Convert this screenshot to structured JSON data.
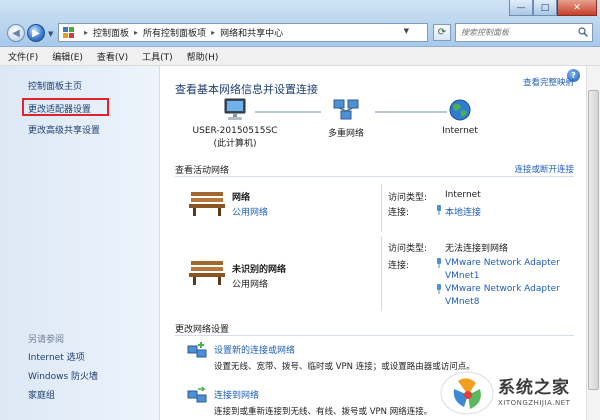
{
  "window": {
    "min_glyph": "—",
    "max_glyph": "□",
    "close_glyph": "✕"
  },
  "address": {
    "crumbs": [
      "控制面板",
      "所有控制面板项",
      "网络和共享中心"
    ],
    "search_placeholder": "搜索控制面板"
  },
  "menu": [
    "文件(F)",
    "编辑(E)",
    "查看(V)",
    "工具(T)",
    "帮助(H)"
  ],
  "left_pane": {
    "home": "控制面板主页",
    "adapter_settings": "更改适配器设置",
    "advanced_sharing": "更改高级共享设置",
    "see_also": "另请参阅",
    "internet_options": "Internet 选项",
    "firewall": "Windows 防火墙",
    "homegroup": "家庭组"
  },
  "main": {
    "title": "查看基本网络信息并设置连接",
    "see_full_map": "查看完整映射",
    "nodes": {
      "computer": "USER-20150515SC",
      "computer_sub": "(此计算机)",
      "multi": "多重网络",
      "internet": "Internet"
    },
    "active_head": "查看活动网络",
    "connect_disconnect": "连接或断开连接",
    "network1": {
      "name": "网络",
      "type": "公用网络",
      "access_label": "访问类型:",
      "access_value": "Internet",
      "conn_label": "连接:",
      "conn_value": "本地连接"
    },
    "network2": {
      "name": "未识别的网络",
      "type": "公用网络",
      "access_label": "访问类型:",
      "access_value": "无法连接到网络",
      "conn_label": "连接:",
      "conn_value1a": "VMware Network Adapter",
      "conn_value1b": "VMnet1",
      "conn_value2a": "VMware Network Adapter",
      "conn_value2b": "VMnet8"
    },
    "change_head": "更改网络设置",
    "task1_link": "设置新的连接或网络",
    "task1_desc": "设置无线、宽带、拨号、临时或 VPN 连接；或设置路由器或访问点。",
    "task2_link": "连接到网络",
    "task2_desc": "连接到或重新连接到无线、有线、拨号或 VPN 网络连接。"
  },
  "help_glyph": "?",
  "watermark": {
    "text": "系统之家",
    "sub": "XITONGZHIJIA.NET"
  },
  "colors": {
    "link": "#1f5fbf",
    "heading": "#1e3e73",
    "highlight": "#e0242b"
  }
}
